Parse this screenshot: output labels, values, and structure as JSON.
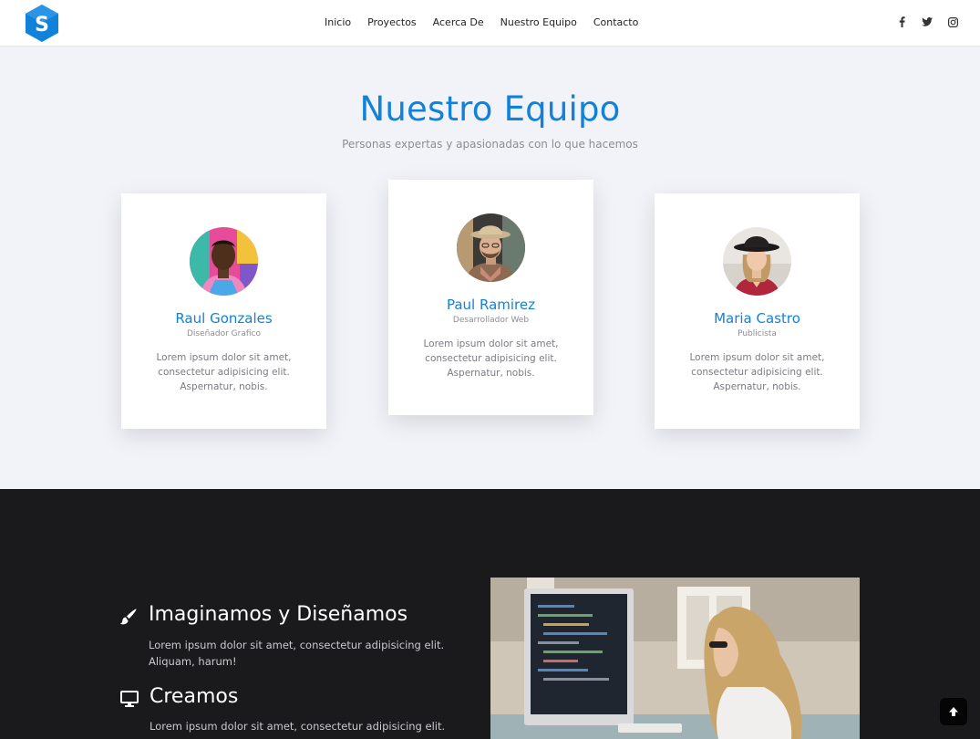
{
  "nav": {
    "links": [
      "Inicio",
      "Proyectos",
      "Acerca De",
      "Nuestro Equipo",
      "Contacto"
    ],
    "logo_letter": "S",
    "social_icons": [
      "facebook-icon",
      "twitter-icon",
      "instagram-icon"
    ]
  },
  "team": {
    "title": "Nuestro Equipo",
    "subtitle": "Personas expertas y apasionadas con lo que hacemos",
    "members": [
      {
        "name": "Raul Gonzales",
        "role": "Diseñador Grafico",
        "text": "Lorem ipsum dolor sit amet, consectetur adipisicing elit. Aspernatur, nobis."
      },
      {
        "name": "Paul Ramirez",
        "role": "Desarrollador Web",
        "text": "Lorem ipsum dolor sit amet, consectetur adipisicing elit. Aspernatur, nobis."
      },
      {
        "name": "Maria Castro",
        "role": "Publicista",
        "text": "Lorem ipsum dolor sit amet, consectetur adipisicing elit. Aspernatur, nobis."
      }
    ]
  },
  "features": [
    {
      "title": "Imaginamos y Diseñamos",
      "icon": "paintbrush-icon",
      "text": "Lorem ipsum dolor sit amet, consectetur adipisicing elit. Aliquam, harum!"
    },
    {
      "title": "Creamos",
      "icon": "desktop-icon",
      "text": "Lorem ipsum dolor sit amet, consectetur adipisicing elit."
    }
  ],
  "colors": {
    "accent": "#1182d9",
    "dark": "#1a1a1c",
    "light_bg": "#f2f3f8"
  }
}
